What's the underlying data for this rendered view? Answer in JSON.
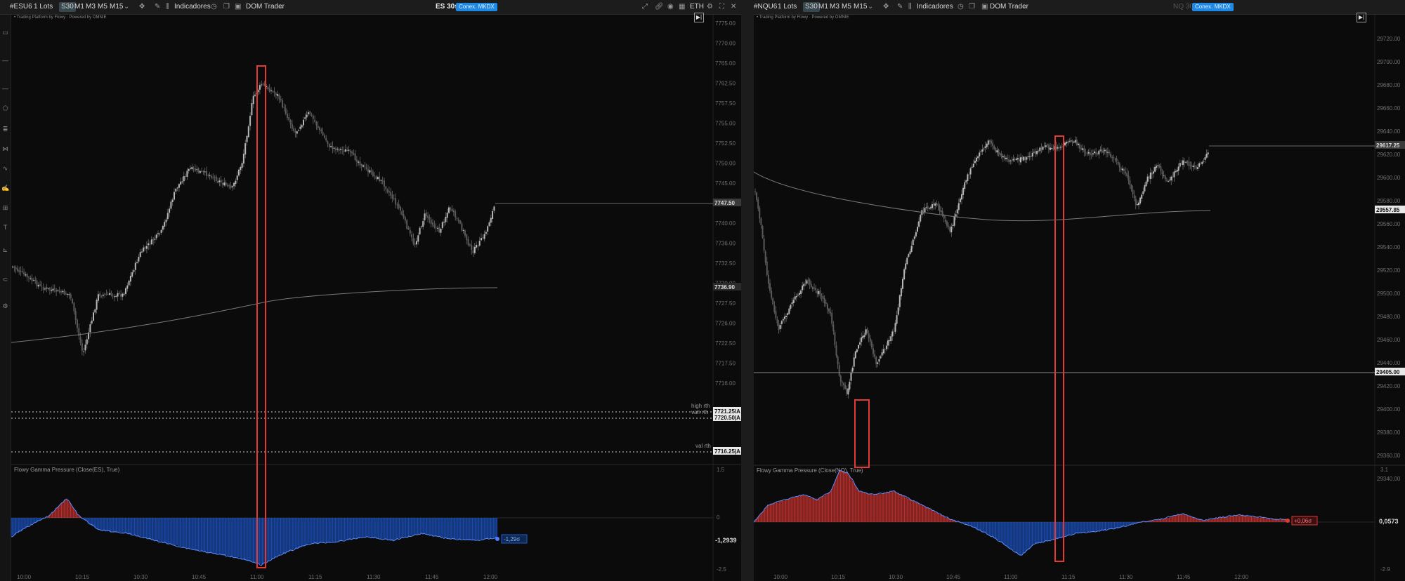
{
  "colors": {
    "background": "#0b0b0b",
    "candle": "#9a9a9a",
    "price_line": "#8a8a8a",
    "highlight_box": "#e53935",
    "positive_fill": "#e53935",
    "negative_fill": "#1e5bd8",
    "accent_badge": "#1e88e5"
  },
  "left": {
    "toolbar": {
      "symbol": "#ESU6",
      "lots": "1 Lots",
      "timeframes": [
        "S30",
        "M1",
        "M3",
        "M5",
        "M15"
      ],
      "indicators_label": "Indicadores",
      "dom_trader_label": "DOM Trader",
      "instrument_title": "ES 30s",
      "badge": "Conex. MKDX",
      "session": "ETH"
    },
    "watermark": "• Trading Platform by Flowy · Powered by OMNIE",
    "price_axis_ticks": [
      "7775.00",
      "7770.00",
      "7765.00",
      "7762.50",
      "7757.50",
      "7755.00",
      "7752.50",
      "7750.00",
      "7745.00",
      "7742.50",
      "7740.00",
      "7736.00",
      "7732.50",
      "7730.00",
      "7727.50",
      "7726.00",
      "7722.50",
      "7717.50",
      "7716.00"
    ],
    "price_tags": {
      "last": "7747.50",
      "vwap": "7736.90",
      "high_rth": "7721.25|A",
      "vah_rth": "7720.50|A",
      "val_rth": "7716.25|A"
    },
    "level_labels": {
      "high": "high rth",
      "vah": "vah rth",
      "val": "val rth"
    },
    "indicator": {
      "title": "Flowy Gamma Pressure (Close(ES), True)",
      "axis_top": "1.5",
      "axis_zero": "0",
      "axis_bottom": "-2.5",
      "value_tag": "-1,29σ",
      "value_axis": "-1,2939"
    },
    "time_axis": [
      "10:00",
      "10:15",
      "10:30",
      "10:45",
      "11:00",
      "11:15",
      "11:30",
      "11:45",
      "12:00"
    ]
  },
  "right": {
    "toolbar": {
      "symbol": "#NQU6",
      "lots": "1 Lots",
      "timeframes": [
        "S30",
        "M1",
        "M3",
        "M5",
        "M15"
      ],
      "indicators_label": "Indicadores",
      "dom_trader_label": "DOM Trader",
      "instrument_title": "NQ 30s",
      "badge": "Conex. MKDX"
    },
    "watermark": "• Trading Platform by Flowy · Powered by OMNIE",
    "price_axis_ticks": [
      "29720.00",
      "29700.00",
      "29680.00",
      "29660.00",
      "29640.00",
      "29620.00",
      "29600.00",
      "29580.00",
      "29560.00",
      "29540.00",
      "29520.00",
      "29500.00",
      "29480.00",
      "29460.00",
      "29440.00",
      "29420.00",
      "29400.00",
      "29380.00",
      "29360.00",
      "29340.00"
    ],
    "price_tags": {
      "last": "29617.25",
      "vwap": "29557.85",
      "level": "29405.00"
    },
    "indicator": {
      "title": "Flowy Gamma Pressure (Close(NQ), True)",
      "axis_top": "3.1",
      "value_tag": "+0,06σ",
      "value_axis": "0,0573",
      "axis_bottom": "-2.9"
    },
    "time_axis": [
      "10:00",
      "10:15",
      "10:30",
      "10:45",
      "11:00",
      "11:15",
      "11:30",
      "11:45",
      "12:00"
    ]
  }
}
